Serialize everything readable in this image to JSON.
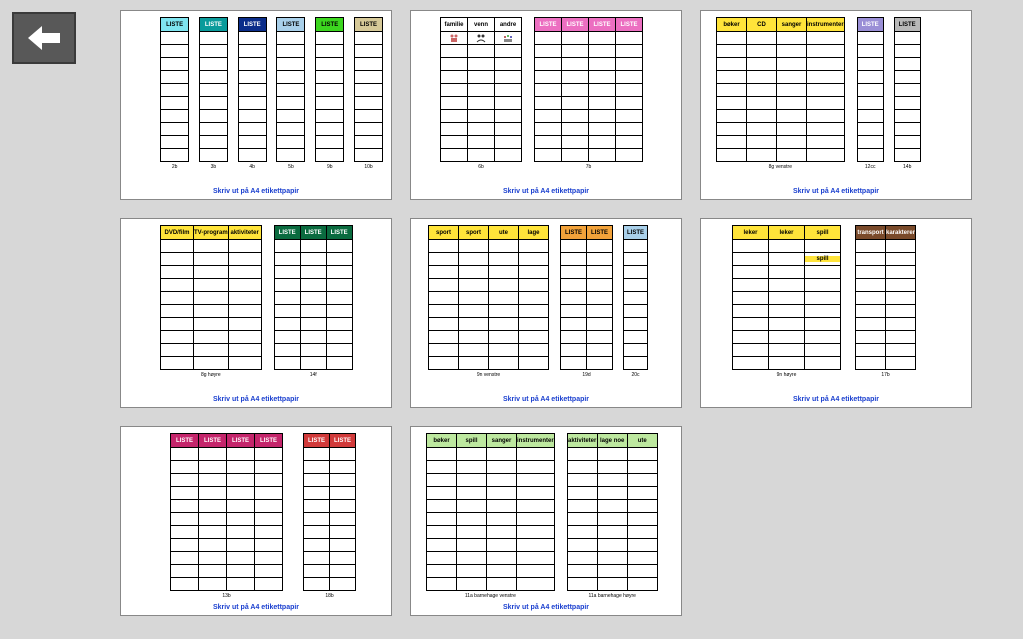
{
  "printLabel": "Skriv ut på A4 etikettpapir",
  "hdr": {
    "liste": "LISTE",
    "boker": "bøker",
    "cd": "CD",
    "sanger": "sanger",
    "instr": "instrumenter",
    "dvd": "DVD/film",
    "tvprog": "TV-program",
    "aktiv": "aktiviteter",
    "sport": "sport",
    "ute": "ute",
    "lage": "lage",
    "leker": "leker",
    "spill": "spill",
    "transport": "transport",
    "karakter": "karakterer",
    "lagenoe": "lage noe",
    "familie": "familie",
    "venn": "venn",
    "andre": "andre"
  },
  "below": {
    "p1": [
      "2b",
      "3b",
      "4b",
      "5b",
      "9b",
      "10b"
    ],
    "p2": [
      "6b",
      "7b"
    ],
    "p3": [
      "8g venstre",
      "12cc",
      "14b"
    ],
    "p4": [
      "8g høyre",
      "14f"
    ],
    "p5": [
      "9n venstre",
      "19d",
      "20c"
    ],
    "p6": [
      "9n høyre",
      "17b"
    ],
    "p7": [
      "13b",
      "18b"
    ],
    "p8": [
      "11a barnehage venstre",
      "11a barnehage høyre"
    ]
  },
  "colors": {
    "cyan": "#7fe5f0",
    "teal": "#0a9b9b",
    "navy": "#0b2d8a",
    "ltblue": "#a9d0ea",
    "lime": "#3cd61f",
    "tan": "#d6c998",
    "pink": "#ec6fc1",
    "yellow": "#ffe43a",
    "purple": "#9a8fd6",
    "grey": "#b8b8b8",
    "dkgreen": "#0a6b3f",
    "orange": "#f2a23a",
    "skyblue": "#a9d0ea",
    "magenta": "#c4256b",
    "red": "#d13a3a",
    "ltgreen": "#bde89f",
    "brown": "#7a4a2a"
  }
}
